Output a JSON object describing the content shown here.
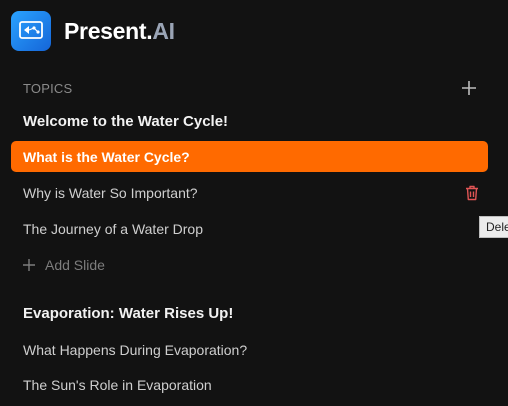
{
  "app": {
    "name_main": "Present.",
    "name_accent": "AI",
    "logo_icon": "presentation-share-icon"
  },
  "topics": {
    "label": "TOPICS",
    "add_icon": "plus-icon"
  },
  "sections": [
    {
      "title": "Welcome to the Water Cycle!",
      "slides": [
        {
          "label": "What is the Water Cycle?",
          "active": true
        },
        {
          "label": "Why is Water So Important?",
          "active": false,
          "hovered": true
        },
        {
          "label": "The Journey of a Water Drop",
          "active": false
        }
      ],
      "add_slide_label": "Add Slide"
    },
    {
      "title": "Evaporation: Water Rises Up!",
      "slides": [
        {
          "label": "What Happens During Evaporation?",
          "active": false
        },
        {
          "label": "The Sun's Role in Evaporation",
          "active": false
        }
      ]
    }
  ],
  "tooltip": {
    "text": "Delete"
  },
  "colors": {
    "accent": "#ff6a00",
    "background": "#121212",
    "delete": "#e05555",
    "logo": "#1e88e5"
  }
}
